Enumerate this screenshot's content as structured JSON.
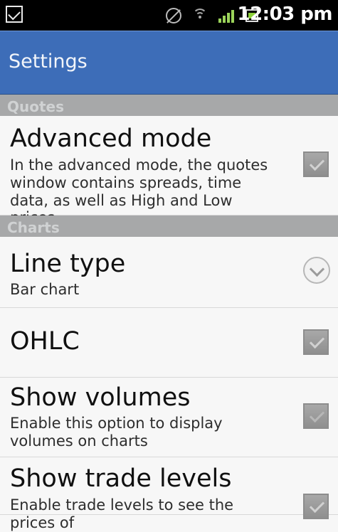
{
  "status_bar": {
    "time": "12:03 pm"
  },
  "app_bar": {
    "title": "Settings"
  },
  "sections": [
    {
      "title": "Quotes",
      "items": [
        {
          "title": "Advanced mode",
          "summary": "In the advanced mode, the quotes window contains spreads, time data, as well as High and Low prices.",
          "checked": true,
          "enabled": true
        }
      ]
    },
    {
      "title": "Charts",
      "items": [
        {
          "title": "Line type",
          "summary": "Bar chart",
          "control": "dropdown-arrow-icon"
        },
        {
          "title": "OHLC",
          "checked": true,
          "enabled": true
        },
        {
          "title": "Show volumes",
          "summary": "Enable this option to display volumes on charts",
          "checked": false,
          "enabled": true
        },
        {
          "title": "Show trade levels",
          "summary": "Enable trade levels to see the prices of",
          "checked": true,
          "enabled": true
        }
      ]
    }
  ]
}
